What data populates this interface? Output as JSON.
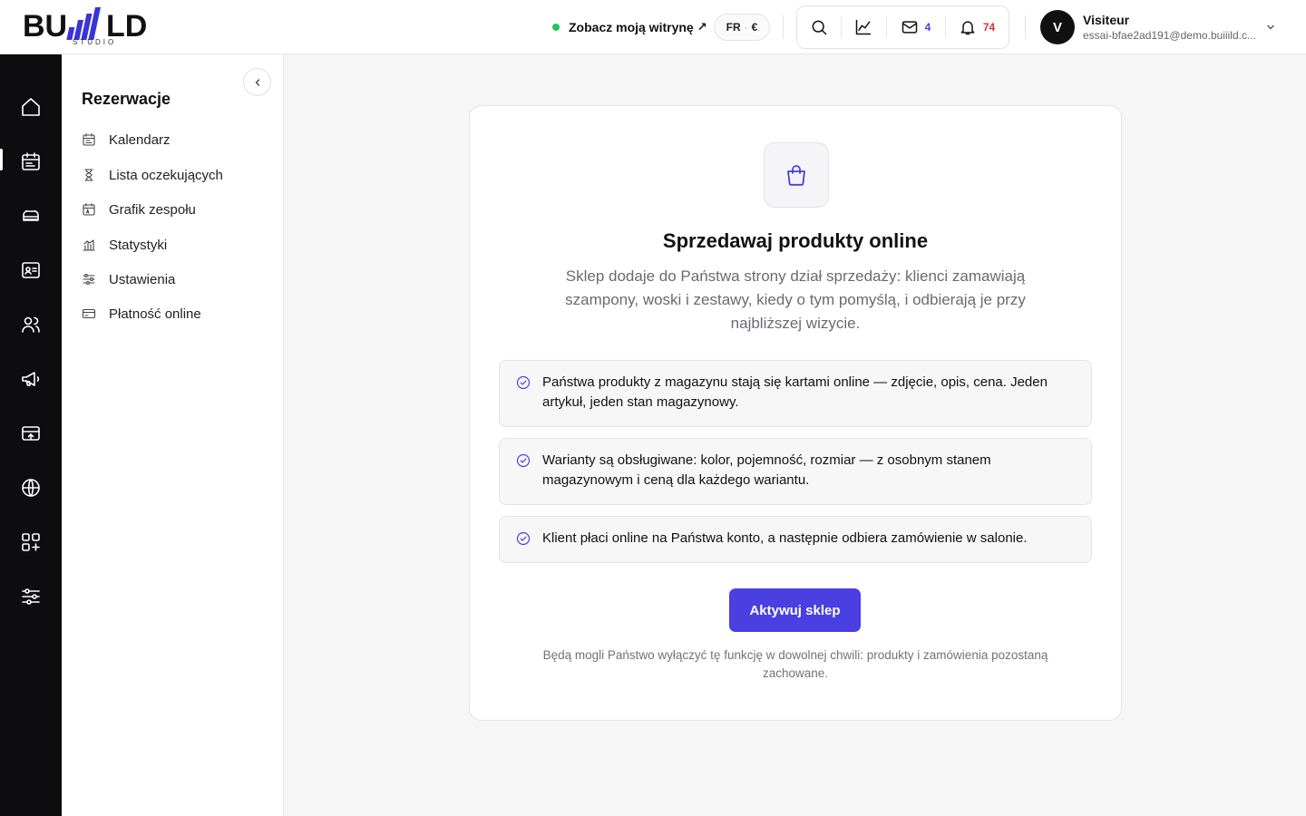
{
  "header": {
    "logo_text": "BUILD",
    "logo_sub": "STUDIO",
    "site_link_label": "Zobacz moją witrynę",
    "site_link_arrow": "↗",
    "lang": "FR",
    "lang_sep": "·",
    "currency": "€",
    "messages_count": "4",
    "notifications_count": "74",
    "user": {
      "initial": "V",
      "name": "Visiteur",
      "email": "essai-bfae2ad191@demo.buiiild.c..."
    }
  },
  "rail": {
    "items": [
      "home-icon",
      "calendar-icon",
      "service-icon",
      "contact-card-icon",
      "users-icon",
      "megaphone-icon",
      "payment-terminal-icon",
      "globe-icon",
      "apps-icon",
      "settings-sliders-icon"
    ],
    "active": "calendar-icon"
  },
  "sidebar": {
    "title": "Rezerwacje",
    "items": [
      {
        "label": "Kalendarz",
        "icon": "calendar-icon"
      },
      {
        "label": "Lista oczekujących",
        "icon": "hourglass-icon"
      },
      {
        "label": "Grafik zespołu",
        "icon": "schedule-icon"
      },
      {
        "label": "Statystyki",
        "icon": "stats-icon"
      },
      {
        "label": "Ustawienia",
        "icon": "sliders-icon"
      },
      {
        "label": "Płatność online",
        "icon": "credit-card-icon"
      }
    ]
  },
  "main": {
    "icon": "shopping-bag-icon",
    "title": "Sprzedawaj produkty online",
    "description": "Sklep dodaje do Państwa strony dział sprzedaży: klienci zamawiają szampony, woski i zestawy, kiedy o tym pomyślą, i odbierają je przy najbliższej wizycie.",
    "features": [
      "Państwa produkty z magazynu stają się kartami online — zdjęcie, opis, cena. Jeden artykuł, jeden stan magazynowy.",
      "Warianty są obsługiwane: kolor, pojemność, rozmiar — z osobnym stanem magazynowym i ceną dla każdego wariantu.",
      "Klient płaci online na Państwa konto, a następnie odbiera zamówienie w salonie."
    ],
    "cta_label": "Aktywuj sklep",
    "footnote": "Będą mogli Państwo wyłączyć tę funkcję w dowolnej chwili: produkty i zamówienia pozostaną zachowane."
  },
  "colors": {
    "accent": "#4a3fe0",
    "status_online": "#22c55e",
    "notification": "#d8323a",
    "rail_bg": "#0d0d0f"
  }
}
